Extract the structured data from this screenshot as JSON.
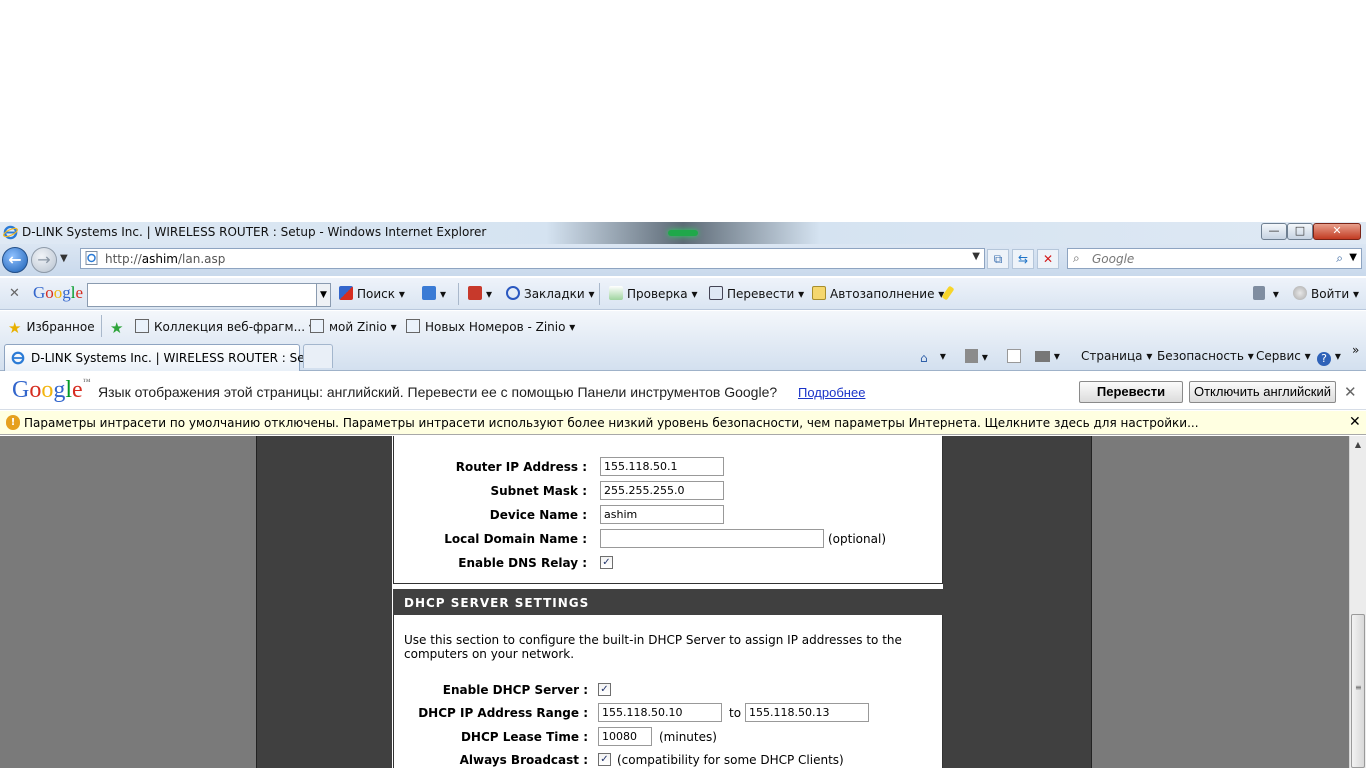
{
  "window": {
    "title": "D-LINK Systems Inc. | WIRELESS ROUTER : Setup - Windows Internet Explorer",
    "min_label": "—",
    "max_label": "□",
    "close_label": "✕"
  },
  "address": {
    "url_prefix": "http://",
    "url_host": "ashim",
    "url_path": "/lan.asp",
    "search_placeholder": "Google"
  },
  "google_toolbar": {
    "logo": "Google",
    "search_value": "",
    "items": {
      "search": "Поиск",
      "bookmarks": "Закладки",
      "spellcheck": "Проверка",
      "translate": "Перевести",
      "autofill": "Автозаполнение",
      "signin": "Войти"
    }
  },
  "favorites": {
    "label": "Избранное",
    "items": [
      "Коллекция веб-фрагм...",
      "мой Zinio",
      "Новых Номеров - Zinio"
    ]
  },
  "tabs": {
    "active": "D-LINK Systems Inc. | WIRELESS ROUTER : Setup"
  },
  "commands": {
    "page": "Страница",
    "safety": "Безопасность",
    "tools": "Сервис"
  },
  "translate_bar": {
    "logo": "Google",
    "message": "Язык отображения этой страницы: английский. Перевести ее с помощью Панели инструментов Google?",
    "more_link": "Подробнее",
    "translate_button": "Перевести",
    "disable_button": "Отключить английский"
  },
  "info_bar": {
    "message": "Параметры интрасети по умолчанию отключены. Параметры интрасети используют более низкий уровень безопасности, чем параметры Интернета. Щелкните здесь для настройки..."
  },
  "router": {
    "lan": {
      "router_ip_label": "Router IP Address :",
      "router_ip_value": "155.118.50.1",
      "subnet_label": "Subnet Mask :",
      "subnet_value": "255.255.255.0",
      "device_name_label": "Device Name :",
      "device_name_value": "ashim",
      "domain_label": "Local Domain Name :",
      "domain_value": "",
      "domain_hint": "(optional)",
      "dns_relay_label": "Enable DNS Relay :",
      "dns_relay_checked": true
    },
    "dhcp": {
      "heading": "DHCP SERVER SETTINGS",
      "description": "Use this section to configure the built-in DHCP Server to assign IP addresses to the computers on your network.",
      "enable_label": "Enable DHCP Server :",
      "enable_checked": true,
      "range_label": "DHCP IP Address Range :",
      "range_start": "155.118.50.10",
      "range_to": "to",
      "range_end": "155.118.50.13",
      "lease_label": "DHCP Lease Time :",
      "lease_value": "10080",
      "lease_unit": "(minutes)",
      "broadcast_label": "Always Broadcast :",
      "broadcast_checked": true,
      "broadcast_hint": "(compatibility for some DHCP Clients)"
    }
  },
  "colors": {
    "page_bg": "#7a7a7a",
    "dark_column": "#404040",
    "section_header": "#404040",
    "info_bar_bg": "#ffffe1",
    "link_blue": "#1a33c8"
  }
}
